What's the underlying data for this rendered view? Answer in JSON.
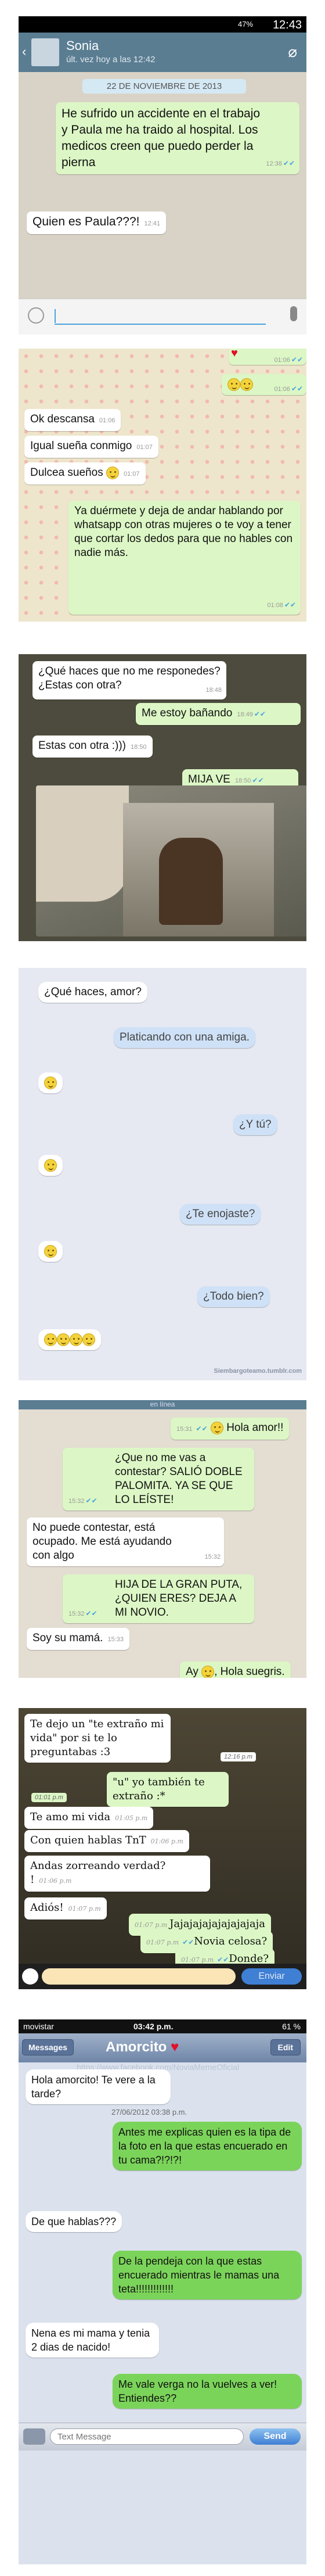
{
  "p1": {
    "status_time": "12:43",
    "battery": "47%",
    "contact_name": "Sonia",
    "last_seen": "últ. vez hoy a las 12:42",
    "date_badge": "22 DE NOVIEMBRE DE 2013",
    "messages": [
      {
        "text": "He sufrido un accidente en el trabajo y Paula me ha traido al hospital. Los medicos creen que puedo perder la pierna",
        "time": "12:38"
      },
      {
        "text": "Quien es Paula???!",
        "time": "12:41"
      }
    ]
  },
  "p2": {
    "messages": [
      {
        "text": "",
        "time": "01:06"
      },
      {
        "text": "",
        "time": "01:06"
      },
      {
        "text": "Ok descansa",
        "time": "01:06"
      },
      {
        "text": "Igual sueña conmigo",
        "time": "01:07"
      },
      {
        "text": "Dulcea sueños",
        "time": "01:07"
      },
      {
        "text": "Ya duérmete y deja de andar hablando por whatsapp con otras mujeres o te voy a tener que cortar los dedos para que no hables con nadie más.",
        "time": "01:08"
      }
    ]
  },
  "p3": {
    "messages": [
      {
        "text": "¿Qué haces que no me responedes? ¿Estas con otra?",
        "time": "18:48"
      },
      {
        "text": "Me estoy bañando",
        "time": "18:49"
      },
      {
        "text": "Estas con otra :)))",
        "time": "18:50"
      },
      {
        "text": "MIJA VE",
        "time": "18:50"
      }
    ]
  },
  "p4": {
    "messages": [
      {
        "text": "¿Qué haces, amor?"
      },
      {
        "text": "Platicando con una amiga."
      },
      {
        "text": "¿Y tú?"
      },
      {
        "text": "¿Te enojaste?"
      },
      {
        "text": "¿Todo bien?"
      }
    ],
    "watermark": "Siembargoteamo.tumblr.com"
  },
  "p5": {
    "header": "en línea",
    "messages": [
      {
        "text": "Hola amor!!",
        "time": "15:31"
      },
      {
        "text": "¿Que no me vas a contestar? SALIÓ DOBLE PALOMITA. YA SE QUE LO LEÍSTE!",
        "time": "15:32"
      },
      {
        "text": "No puede contestar, está ocupado. Me está ayudando con algo",
        "time": "15:32"
      },
      {
        "text": "HIJA DE LA GRAN PUTA, ¿QUIEN ERES? DEJA A MI NOVIO.",
        "time": "15:32"
      },
      {
        "text": "Soy su mamá.",
        "time": "15:33"
      },
      {
        "text": "Ay",
        "time": ""
      },
      {
        "text": ", Hola suegris.",
        "time": ""
      }
    ]
  },
  "p6": {
    "messages": [
      {
        "text": "Te dejo un \"te extraño mi vida\" por si te lo preguntabas :3",
        "time": "12:16 p.m"
      },
      {
        "text": "\"u\" yo también te extraño :*",
        "time": "01:01 p.m"
      },
      {
        "text": "Te amo mi vida",
        "time": "01:05 p.m"
      },
      {
        "text": "Con quien hablas TnT",
        "time": "01:06 p.m"
      },
      {
        "text": "Andas zorreando verdad? !",
        "time": "01:06 p.m"
      },
      {
        "text": "Adiós!",
        "time": "01:07 p.m"
      },
      {
        "text": "Jajajajajajajajajaja",
        "time": "01:07 p.m"
      },
      {
        "text": "Novia celosa?",
        "time": "01:07 p.m"
      },
      {
        "text": "Donde?",
        "time": "01:07 p.m"
      }
    ],
    "send_label": "Enviar"
  },
  "p7": {
    "carrier": "movistar",
    "time": "03:42 p.m.",
    "battery": "61 %",
    "back_label": "Messages",
    "title": "Amorcito",
    "edit_label": "Edit",
    "watermark": "https://www.facebook.com/NoviaMemeOficial",
    "date_label": "27/06/2012 03:38 p.m.",
    "messages": [
      {
        "text": "Hola amorcito! Te vere a la tarde?"
      },
      {
        "text": "Antes me explicas quien es la tipa de la foto en la que estas encuerado en tu cama?!?!?!"
      },
      {
        "text": "De que hablas???"
      },
      {
        "text": "De la pendeja con la que estas encuerado mientras le mamas una teta!!!!!!!!!!!!!"
      },
      {
        "text": "Nena es mi mama y tenia 2 dias de nacido!"
      },
      {
        "text": "Me vale verga no la vuelves a ver! Entiendes??"
      }
    ],
    "placeholder": "Text Message",
    "send_label": "Send"
  },
  "colors": {
    "whatsapp_header": "#5a7d92",
    "ios_green": "#7bd45a",
    "ios_blue": "#3f7fd4"
  }
}
